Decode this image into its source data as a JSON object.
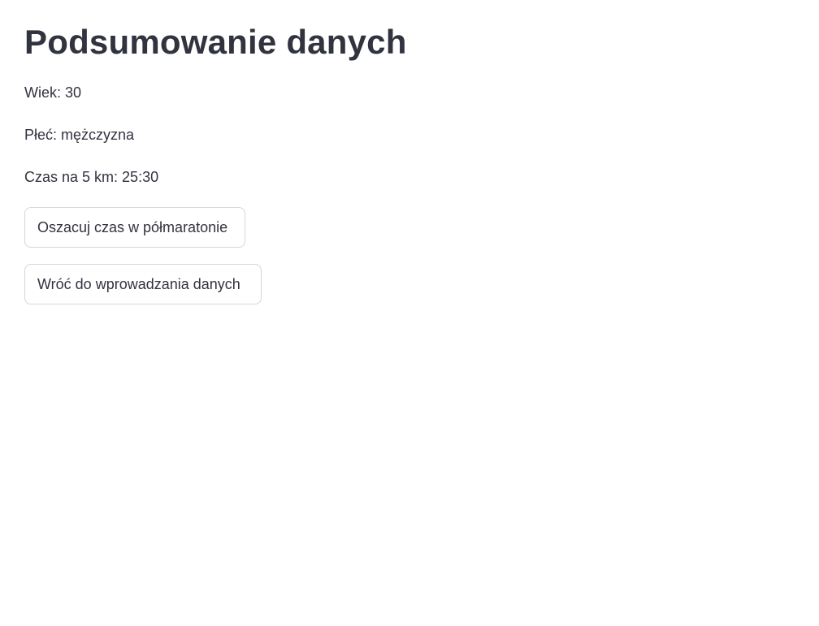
{
  "summary": {
    "title": "Podsumowanie danych",
    "age_line": "Wiek: 30",
    "sex_line": "Płeć: mężczyzna",
    "time_line": "Czas na 5 km: 25:30"
  },
  "actions": {
    "estimate_label": "Oszacuj czas w półmaratonie",
    "back_label": "Wróć do wprowadzania danych"
  },
  "colors": {
    "text": "#31333f",
    "button_border": "#d5d6db",
    "background": "#ffffff"
  }
}
